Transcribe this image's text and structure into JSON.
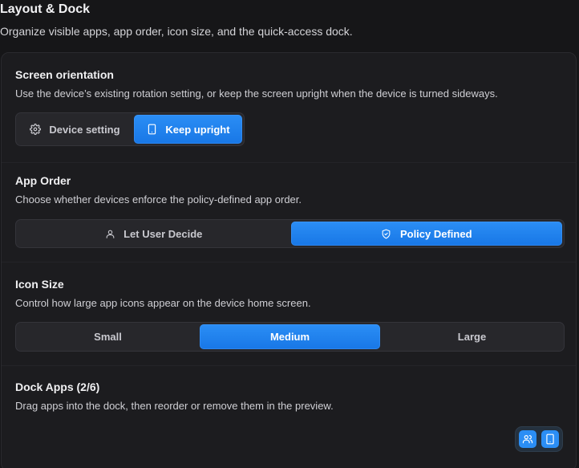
{
  "header": {
    "title": "Layout & Dock",
    "subtitle": "Organize visible apps, app order, icon size, and the quick-access dock."
  },
  "orientation": {
    "title": "Screen orientation",
    "description": "Use the device’s existing rotation setting, or keep the screen upright when the device is turned sideways.",
    "options": [
      {
        "label": "Device setting",
        "icon": "gear-icon",
        "selected": false
      },
      {
        "label": "Keep upright",
        "icon": "tablet-icon",
        "selected": true
      }
    ]
  },
  "app_order": {
    "title": "App Order",
    "description": "Choose whether devices enforce the policy-defined app order.",
    "options": [
      {
        "label": "Let User Decide",
        "icon": "user-icon",
        "selected": false
      },
      {
        "label": "Policy Defined",
        "icon": "shield-icon",
        "selected": true
      }
    ]
  },
  "icon_size": {
    "title": "Icon Size",
    "description": "Control how large app icons appear on the device home screen.",
    "options": [
      {
        "label": "Small",
        "selected": false
      },
      {
        "label": "Medium",
        "selected": true
      },
      {
        "label": "Large",
        "selected": false
      }
    ]
  },
  "dock": {
    "title": "Dock Apps (2/6)",
    "description": "Drag apps into the dock, then reorder or remove them in the preview."
  },
  "floating_actions": {
    "items": [
      {
        "icon": "users-icon"
      },
      {
        "icon": "tablet-icon"
      }
    ]
  },
  "colors": {
    "accent": "#1f86f0",
    "background": "#161618",
    "panel": "#1c1c1f"
  }
}
